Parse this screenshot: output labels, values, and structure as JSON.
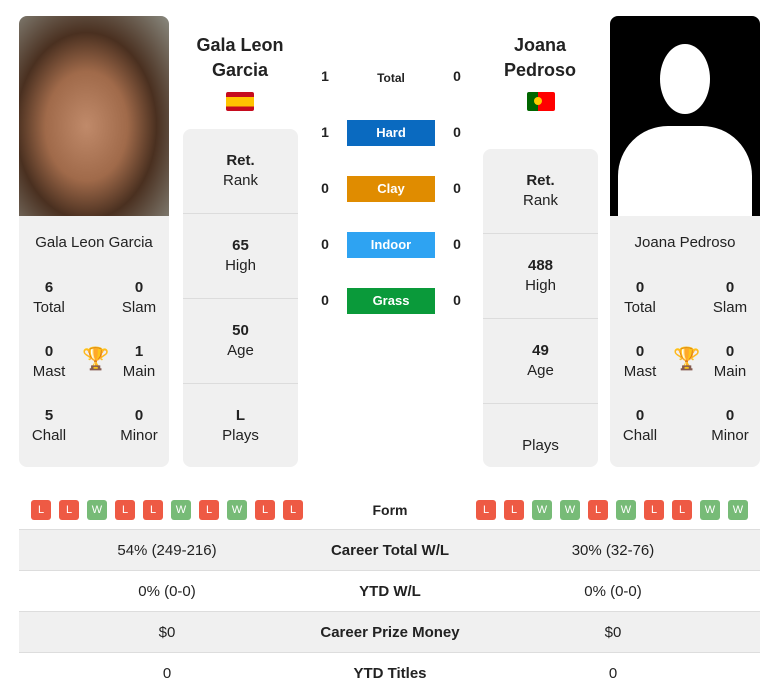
{
  "player1": {
    "name": "Gala Leon Garcia",
    "name_line1": "Gala Leon",
    "name_line2": "Garcia",
    "country_flag": "spain-flag",
    "stats": {
      "total": "6",
      "total_label": "Total",
      "slam": "0",
      "slam_label": "Slam",
      "mast": "0",
      "mast_label": "Mast",
      "main": "1",
      "main_label": "Main",
      "chall": "5",
      "chall_label": "Chall",
      "minor": "0",
      "minor_label": "Minor"
    },
    "rank": [
      {
        "value": "Ret.",
        "label": "Rank"
      },
      {
        "value": "65",
        "label": "High"
      },
      {
        "value": "50",
        "label": "Age"
      },
      {
        "value": "L",
        "label": "Plays"
      }
    ],
    "form": [
      "L",
      "L",
      "W",
      "L",
      "L",
      "W",
      "L",
      "W",
      "L",
      "L"
    ]
  },
  "player2": {
    "name": "Joana Pedroso",
    "name_line1": "Joana",
    "name_line2": "Pedroso",
    "country_flag": "portugal-flag",
    "stats": {
      "total": "0",
      "total_label": "Total",
      "slam": "0",
      "slam_label": "Slam",
      "mast": "0",
      "mast_label": "Mast",
      "main": "0",
      "main_label": "Main",
      "chall": "0",
      "chall_label": "Chall",
      "minor": "0",
      "minor_label": "Minor"
    },
    "rank": [
      {
        "value": "Ret.",
        "label": "Rank"
      },
      {
        "value": "488",
        "label": "High"
      },
      {
        "value": "49",
        "label": "Age"
      },
      {
        "value": "",
        "label": "Plays"
      }
    ],
    "form": [
      "L",
      "L",
      "W",
      "W",
      "L",
      "W",
      "L",
      "L",
      "W",
      "W"
    ]
  },
  "h2h": [
    {
      "label": "Total",
      "p1": "1",
      "p2": "0",
      "color": ""
    },
    {
      "label": "Hard",
      "p1": "1",
      "p2": "0",
      "color": "#0a6ac0"
    },
    {
      "label": "Clay",
      "p1": "0",
      "p2": "0",
      "color": "#e08c00"
    },
    {
      "label": "Indoor",
      "p1": "0",
      "p2": "0",
      "color": "#2ea3f2"
    },
    {
      "label": "Grass",
      "p1": "0",
      "p2": "0",
      "color": "#0a9a3a"
    }
  ],
  "form_label": "Form",
  "colors": {
    "win": "#77bb77",
    "loss": "#ee5a44"
  },
  "table": [
    {
      "label": "Career Total W/L",
      "p1": "54% (249-216)",
      "p2": "30% (32-76)"
    },
    {
      "label": "YTD W/L",
      "p1": "0% (0-0)",
      "p2": "0% (0-0)"
    },
    {
      "label": "Career Prize Money",
      "p1": "$0",
      "p2": "$0"
    },
    {
      "label": "YTD Titles",
      "p1": "0",
      "p2": "0"
    }
  ]
}
